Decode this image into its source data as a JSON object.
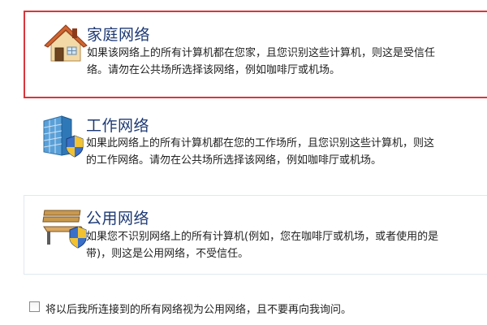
{
  "options": {
    "home": {
      "title": "家庭网络",
      "desc_line1": "如果该网络上的所有计算机都在您家，且您识别这些计算机，则这是受信任",
      "desc_line2": "络。请勿在公共场所选择该网络，例如咖啡厅或机场。",
      "icon": "house-icon",
      "selected": true
    },
    "work": {
      "title": "工作网络",
      "desc_line1": "如果此网络上的所有计算机都在您的工作场所，且您识别这些计算机，则这",
      "desc_line2": "的工作网络。请勿在公共场所选择该网络，例如咖啡厅或机场。",
      "icon": "office-building-icon"
    },
    "public": {
      "title": "公用网络",
      "desc_line1": "如果您不识别网络上的所有计算机(例如，您在咖啡厅或机场，或者使用的是",
      "desc_line2": "带)，则这是公用网络，不受信任。",
      "icon": "park-bench-icon"
    }
  },
  "checkbox": {
    "label": "将以后我所连接到的所有网络视为公用网络，且不要再向我询问。",
    "checked": false
  },
  "colors": {
    "selection_border": "#d9363b",
    "title_text": "#1e3a75"
  }
}
